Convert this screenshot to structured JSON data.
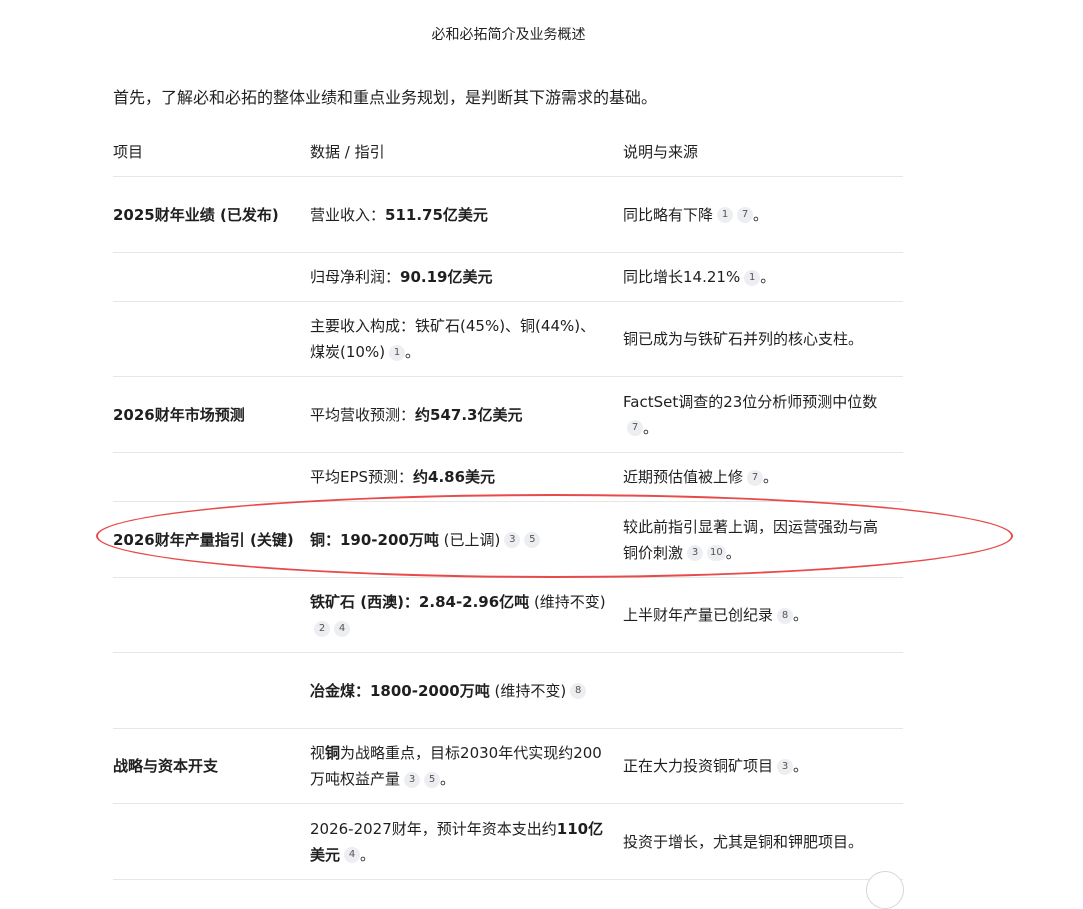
{
  "title": "必和必拓简介及业务概述",
  "intro": "首先，了解必和必拓的整体业绩和重点业务规划，是判断其下游需求的基础。",
  "table": {
    "headers": [
      "项目",
      "数据 / 指引",
      "说明与来源"
    ],
    "rows": [
      {
        "item": "2025财年业绩 (已发布)",
        "data_pre": "营业收入：",
        "data_bold": "511.75亿美元",
        "data_post": "",
        "data_badges": [],
        "note": "同比略有下降",
        "note_badges": [
          "1",
          "7"
        ]
      },
      {
        "item": "",
        "data_pre": "归母净利润：",
        "data_bold": "90.19亿美元",
        "data_post": "",
        "data_badges": [],
        "note": "同比增长14.21%",
        "note_badges": [
          "1"
        ]
      },
      {
        "item": "",
        "data_pre": "主要收入构成：铁矿石(45%)、铜(44%)、煤炭(10%)",
        "data_bold": "",
        "data_post": "",
        "data_badges": [
          "1"
        ],
        "note": "铜已成为与铁矿石并列的核心支柱。",
        "note_badges": []
      },
      {
        "item": "2026财年市场预测",
        "data_pre": "平均营收预测：",
        "data_bold": "约547.3亿美元",
        "data_post": "",
        "data_badges": [],
        "note": "FactSet调查的23位分析师预测中位数",
        "note_badges": [
          "7"
        ]
      },
      {
        "item": "",
        "data_pre": "平均EPS预测：",
        "data_bold": "约4.86美元",
        "data_post": "",
        "data_badges": [],
        "note": "近期预估值被上修",
        "note_badges": [
          "7"
        ]
      },
      {
        "item": "2026财年产量指引 (关键)",
        "data_pre": "",
        "data_bold": "铜：190-200万吨",
        "data_post": " (已上调)",
        "data_badges": [
          "3",
          "5"
        ],
        "note": "较此前指引显著上调，因运营强劲与高铜价刺激",
        "note_badges": [
          "3",
          "10"
        ]
      },
      {
        "item": "",
        "data_pre": "",
        "data_bold": "铁矿石 (西澳)：2.84-2.96亿吨",
        "data_post": " (维持不变)",
        "data_badges": [
          "2",
          "4"
        ],
        "note": "上半财年产量已创纪录",
        "note_badges": [
          "8"
        ]
      },
      {
        "item": "",
        "data_pre": "",
        "data_bold": "冶金煤：1800-2000万吨",
        "data_post": " (维持不变)",
        "data_badges": [
          "8"
        ],
        "note": "",
        "note_badges": []
      },
      {
        "item": "战略与资本开支",
        "data_pre": "视",
        "data_bold": "铜",
        "data_post": "为战略重点，目标2030年代实现约200万吨权益产量",
        "data_badges": [
          "3",
          "5"
        ],
        "note": "正在大力投资铜矿项目",
        "note_badges": [
          "3"
        ]
      },
      {
        "item": "",
        "data_pre": "2026-2027财年，预计年资本支出约",
        "data_bold": "110亿美元",
        "data_post": "",
        "data_badges": [
          "4"
        ],
        "note": "投资于增长，尤其是铜和钾肥项目。",
        "note_badges": []
      }
    ]
  },
  "colors": {
    "highlight_ellipse": "#e84a4a",
    "badge_bg": "#eceef1"
  }
}
